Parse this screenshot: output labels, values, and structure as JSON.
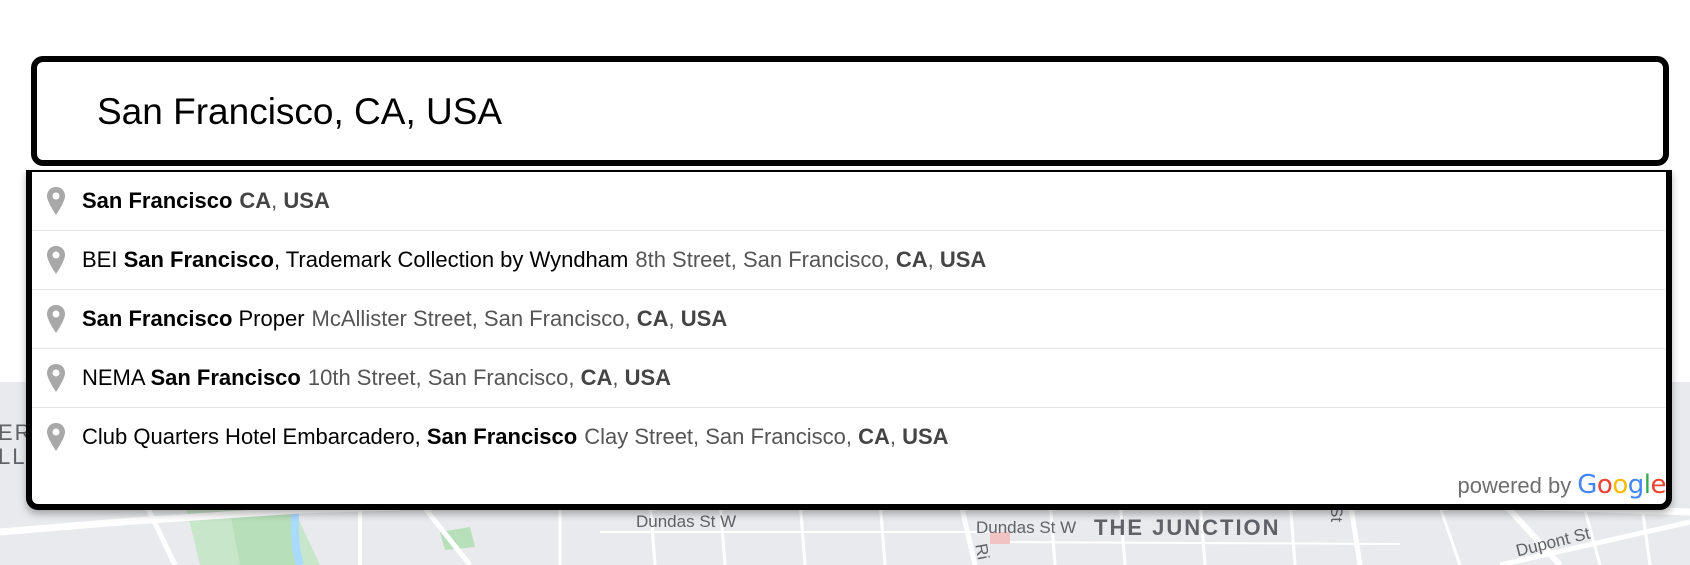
{
  "search": {
    "value": "San Francisco, CA, USA"
  },
  "suggestions": [
    {
      "main_parts": [
        {
          "text": "San Francisco",
          "bold": true
        }
      ],
      "secondary_parts": [
        {
          "text": "CA",
          "bold": true
        },
        {
          "text": ", ",
          "bold": false
        },
        {
          "text": "USA",
          "bold": true
        }
      ]
    },
    {
      "main_parts": [
        {
          "text": "BEI ",
          "bold": false
        },
        {
          "text": "San Francisco",
          "bold": true
        },
        {
          "text": ", Trademark Collection by Wyndham",
          "bold": false
        }
      ],
      "secondary_parts": [
        {
          "text": "8th Street, San Francisco, ",
          "bold": false
        },
        {
          "text": "CA",
          "bold": true
        },
        {
          "text": ", ",
          "bold": false
        },
        {
          "text": "USA",
          "bold": true
        }
      ]
    },
    {
      "main_parts": [
        {
          "text": "San Francisco",
          "bold": true
        },
        {
          "text": " Proper",
          "bold": false
        }
      ],
      "secondary_parts": [
        {
          "text": "McAllister Street, San Francisco, ",
          "bold": false
        },
        {
          "text": "CA",
          "bold": true
        },
        {
          "text": ", ",
          "bold": false
        },
        {
          "text": "USA",
          "bold": true
        }
      ]
    },
    {
      "main_parts": [
        {
          "text": "NEMA ",
          "bold": false
        },
        {
          "text": "San Francisco",
          "bold": true
        }
      ],
      "secondary_parts": [
        {
          "text": "10th Street, San Francisco, ",
          "bold": false
        },
        {
          "text": "CA",
          "bold": true
        },
        {
          "text": ", ",
          "bold": false
        },
        {
          "text": "USA",
          "bold": true
        }
      ]
    },
    {
      "main_parts": [
        {
          "text": "Club Quarters Hotel Embarcadero, ",
          "bold": false
        },
        {
          "text": "San Francisco",
          "bold": true
        }
      ],
      "secondary_parts": [
        {
          "text": "Clay Street, San Francisco, ",
          "bold": false
        },
        {
          "text": "CA",
          "bold": true
        },
        {
          "text": ", ",
          "bold": false
        },
        {
          "text": "USA",
          "bold": true
        }
      ]
    }
  ],
  "icons": {
    "suggestion": "map-pin-icon"
  },
  "attribution": {
    "prefix": "powered by",
    "logo_letters": [
      {
        "char": "G",
        "color": "#4285F4"
      },
      {
        "char": "o",
        "color": "#EA4335"
      },
      {
        "char": "o",
        "color": "#FBBC05"
      },
      {
        "char": "g",
        "color": "#4285F4"
      },
      {
        "char": "l",
        "color": "#34A853"
      },
      {
        "char": "e",
        "color": "#EA4335"
      }
    ]
  },
  "map": {
    "labels": {
      "dundas_left": "Dundas St W",
      "dundas_right": "Dundas St W",
      "neighbourhood": "THE JUNCTION",
      "dupont": "Dupont St",
      "street_st": "St",
      "street_ri": "Ri",
      "edge_top": "ER",
      "edge_bottom": "LL"
    },
    "colors": {
      "background": "#e8eaed",
      "road": "#ffffff",
      "park": "#c5e8c5",
      "water": "#aadaff"
    }
  }
}
